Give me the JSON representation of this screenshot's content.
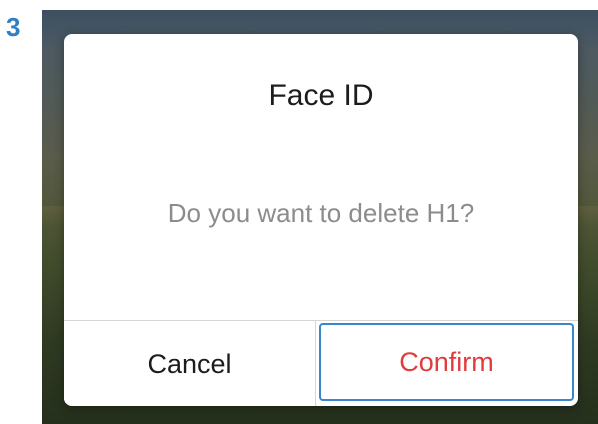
{
  "step": {
    "number": "3"
  },
  "dialog": {
    "title": "Face ID",
    "message": "Do you want to delete H1?",
    "cancel_label": "Cancel",
    "confirm_label": "Confirm"
  },
  "colors": {
    "step_number": "#2f7fc4",
    "confirm_text": "#e03c3c",
    "focus_border": "#3a86c8",
    "message_text": "#8c8c8c"
  }
}
